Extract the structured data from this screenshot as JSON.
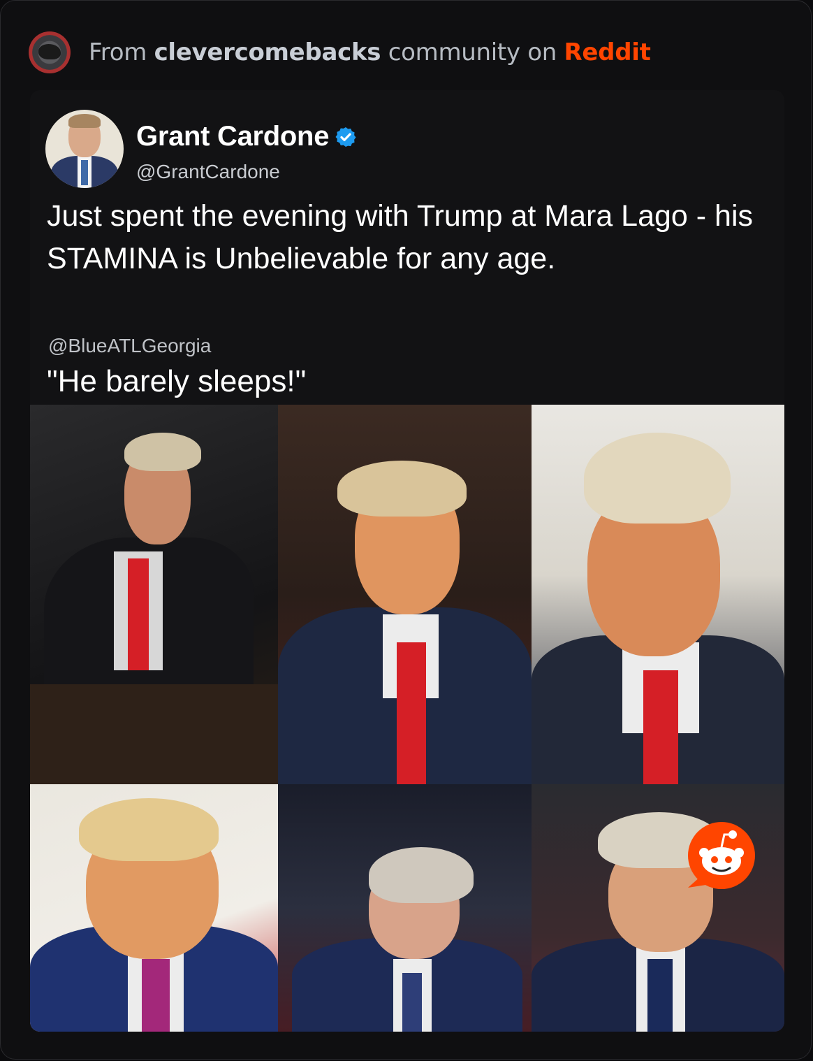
{
  "source_bar": {
    "prefix": "From",
    "community": "clevercomebacks",
    "middle": "community on",
    "platform": "Reddit",
    "icon": "community-avatar-icon"
  },
  "tweet": {
    "author_name": "Grant Cardone",
    "verified": true,
    "handle": "@GrantCardone",
    "text": "Just spent the evening with Trump at Mara Lago - his STAMINA is Unbelievable for any age."
  },
  "reply": {
    "handle": "@BlueATLGeorgia",
    "text": "\"He barely sleeps!\""
  },
  "photos": [
    {
      "name": "photo-1"
    },
    {
      "name": "photo-2"
    },
    {
      "name": "photo-3"
    },
    {
      "name": "photo-4"
    },
    {
      "name": "photo-5"
    },
    {
      "name": "photo-6"
    }
  ],
  "colors": {
    "accent": "#ff4500",
    "verified": "#1d9bf0",
    "background": "#0f0f11"
  },
  "watermark_icon": "reddit-snoo-icon"
}
